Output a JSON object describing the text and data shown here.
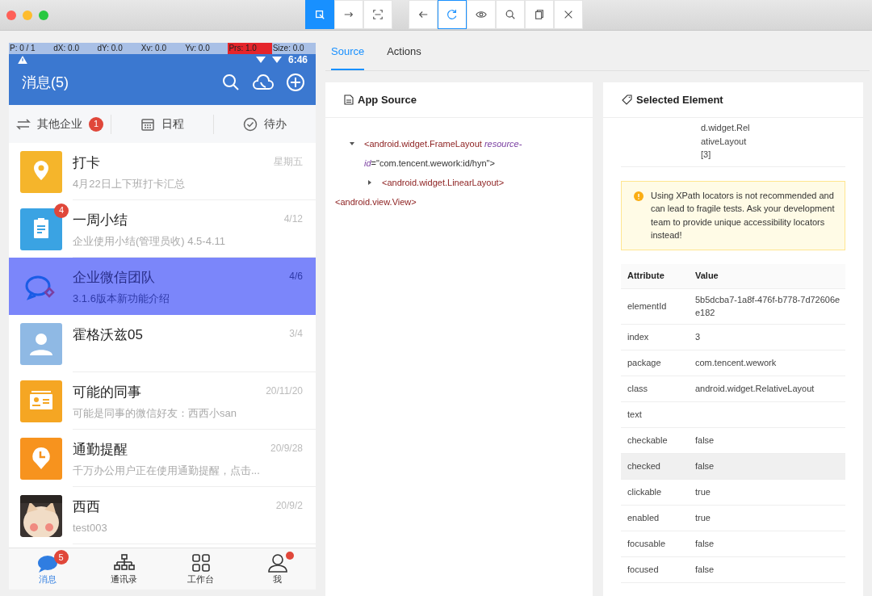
{
  "toolbar": {
    "groups": [
      [
        {
          "kind": "select",
          "selected": true
        },
        {
          "kind": "swipe",
          "selected": false
        },
        {
          "kind": "tap-area",
          "selected": false
        }
      ],
      [
        {
          "kind": "back",
          "selected": false
        },
        {
          "kind": "refresh",
          "selected": true
        },
        {
          "kind": "eye",
          "selected": false
        },
        {
          "kind": "search",
          "selected": false
        },
        {
          "kind": "copy",
          "selected": false
        },
        {
          "kind": "close",
          "selected": false
        }
      ]
    ]
  },
  "device": {
    "pointer_overlay": [
      {
        "text": "P: 0 / 1",
        "highlighted": false
      },
      {
        "text": "dX: 0.0",
        "highlighted": false
      },
      {
        "text": "dY: 0.0",
        "highlighted": false
      },
      {
        "text": "Xv: 0.0",
        "highlighted": false
      },
      {
        "text": "Yv: 0.0",
        "highlighted": false
      },
      {
        "text": "Prs: 1.0",
        "highlighted": true
      },
      {
        "text": "Size: 0.0",
        "highlighted": false
      }
    ],
    "status_time": "6:46",
    "title": "消息(5)",
    "filters": [
      {
        "kind": "switch",
        "label": "其他企业",
        "badge": "1"
      },
      {
        "kind": "calendar",
        "label": "日程"
      },
      {
        "kind": "check",
        "label": "待办"
      }
    ],
    "messages": [
      {
        "kind": "pin",
        "title": "打卡",
        "time": "星期五",
        "preview": "4月22日上下班打卡汇总",
        "selected": false
      },
      {
        "kind": "clipboard",
        "title": "一周小结",
        "time": "4/12",
        "preview": "企业使用小结(管理员收) 4.5-4.11",
        "badge": "4",
        "selected": false
      },
      {
        "kind": "chat",
        "title": "企业微信团队",
        "time": "4/6",
        "preview": "3.1.6版本新功能介绍",
        "selected": true
      },
      {
        "kind": "person",
        "title": "霍格沃兹05",
        "time": "3/4",
        "selected": false
      },
      {
        "kind": "card",
        "title": "可能的同事",
        "time": "20/11/20",
        "preview": "可能是同事的微信好友：西西小san",
        "selected": false
      },
      {
        "kind": "clock",
        "title": "通勤提醒",
        "time": "20/9/28",
        "preview": "千万办公用户正在使用通勤提醒，点击...",
        "selected": false
      },
      {
        "kind": "picture",
        "title": "西西",
        "time": "20/9/2",
        "preview": "test003",
        "selected": false
      }
    ],
    "nav": [
      {
        "kind": "chat",
        "label": "消息",
        "badge": "5",
        "selected": true,
        "dot": false
      },
      {
        "kind": "org",
        "label": "通讯录",
        "selected": false,
        "dot": false
      },
      {
        "kind": "grid",
        "label": "工作台",
        "selected": false,
        "dot": false
      },
      {
        "kind": "person",
        "label": "我",
        "selected": false,
        "dot": true
      }
    ]
  },
  "tabs": [
    {
      "label": "Source",
      "selected": true
    },
    {
      "label": "Actions",
      "selected": false
    }
  ],
  "app_source": {
    "title": "App Source",
    "tree": [
      {
        "tag": "<android.widget.FrameLayout",
        "attr_name": "resource-id",
        "attr_value": "=\"com.tencent.wework:id/hyn\">",
        "expanded": true,
        "children": [
          {
            "tag": "<android.widget.LinearLayout>",
            "expanded": false
          }
        ]
      },
      {
        "tag": "<android.view.View>"
      }
    ]
  },
  "selected_element": {
    "title": "Selected Element",
    "xpath_fragment": [
      "d.widget.Rel",
      "ativeLayout",
      "[3]"
    ],
    "warning": "Using XPath locators is not recommended and can lead to fragile tests. Ask your development team to provide unique accessibility locators instead!",
    "columns": [
      "Attribute",
      "Value"
    ],
    "rows": [
      {
        "attribute": "elementId",
        "value": "5b5dcba7-1a8f-476f-b778-7d72606ee182",
        "selected": false
      },
      {
        "attribute": "index",
        "value": "3",
        "selected": false
      },
      {
        "attribute": "package",
        "value": "com.tencent.wework",
        "selected": false
      },
      {
        "attribute": "class",
        "value": "android.widget.RelativeLayout",
        "selected": false
      },
      {
        "attribute": "text",
        "selected": false
      },
      {
        "attribute": "checkable",
        "value": "false",
        "selected": false
      },
      {
        "attribute": "checked",
        "value": "false",
        "selected": true
      },
      {
        "attribute": "clickable",
        "value": "true",
        "selected": false
      },
      {
        "attribute": "enabled",
        "value": "true",
        "selected": false
      },
      {
        "attribute": "focusable",
        "value": "false",
        "selected": false
      },
      {
        "attribute": "focused",
        "value": "false",
        "selected": false
      }
    ]
  }
}
